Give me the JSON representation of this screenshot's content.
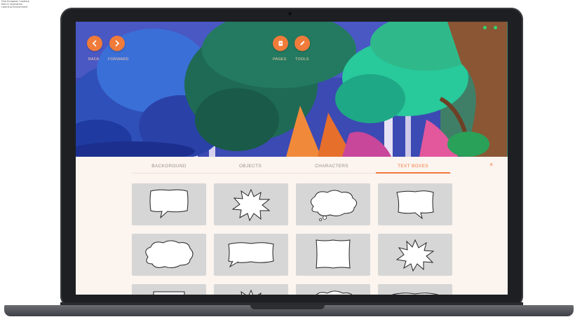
{
  "caption": {
    "lines": [
      "First European Creative",
      "Kids & Innovative",
      "Learning Environment"
    ]
  },
  "toolbar": {
    "back_label": "BACK",
    "forward_label": "FORWARD",
    "pages_label": "PAGES",
    "tools_label": "TOOLS"
  },
  "tabs": [
    {
      "label": "BACKGROUND",
      "active": false
    },
    {
      "label": "OBJECTS",
      "active": false
    },
    {
      "label": "CHARACTERS",
      "active": false
    },
    {
      "label": "TEXT BOXES",
      "active": true
    }
  ],
  "close_label": "×",
  "colors": {
    "accent": "#f07b3a",
    "tile_bg": "#d6d6d6",
    "panel_bg": "#fbf4ef",
    "status_dot": "#34d36f"
  },
  "text_boxes": [
    {
      "shape": "square-bubble"
    },
    {
      "shape": "burst"
    },
    {
      "shape": "cloud-thought"
    },
    {
      "shape": "wavy-square"
    },
    {
      "shape": "cloud"
    },
    {
      "shape": "wavy-rectangle"
    },
    {
      "shape": "wavy-square"
    },
    {
      "shape": "burst"
    },
    {
      "shape": "rectangle"
    },
    {
      "shape": "burst"
    },
    {
      "shape": "cloud"
    },
    {
      "shape": "wavy-rectangle"
    }
  ]
}
